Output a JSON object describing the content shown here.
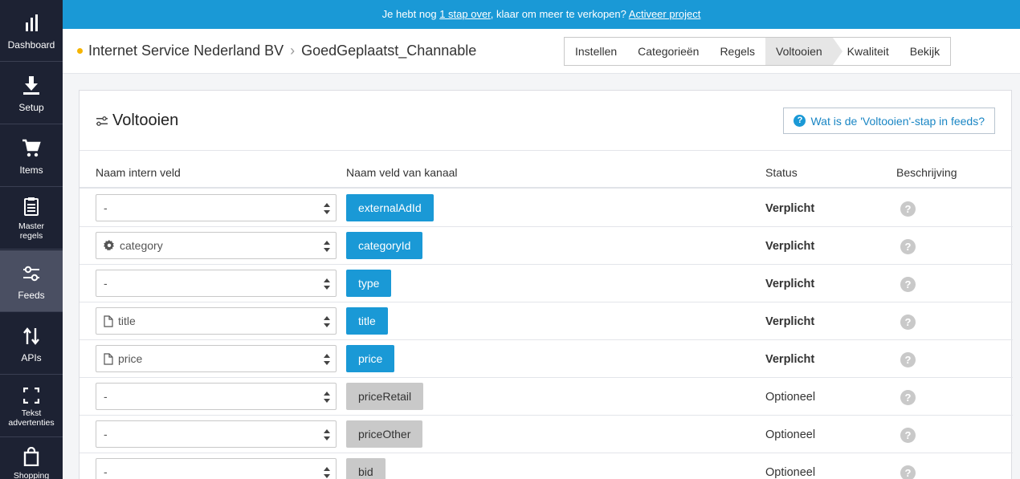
{
  "sidebar": {
    "items": [
      {
        "label": "Dashboard",
        "icon": "bar-chart-icon"
      },
      {
        "label": "Setup",
        "icon": "download-icon"
      },
      {
        "label": "Items",
        "icon": "cart-icon"
      },
      {
        "label": "Master regels",
        "icon": "clipboard-icon"
      },
      {
        "label": "Feeds",
        "icon": "sliders-icon",
        "active": true
      },
      {
        "label": "APIs",
        "icon": "arrows-updown-icon"
      },
      {
        "label": "Tekst advertenties",
        "icon": "frame-corners-icon"
      },
      {
        "label": "Shopping",
        "icon": "shopping-bag-icon"
      }
    ]
  },
  "banner": {
    "prefix": "Je hebt nog ",
    "link1": "1 stap over",
    "middle": ", klaar om meer te verkopen? ",
    "link2": "Activeer project"
  },
  "header": {
    "company": "Internet Service Nederland BV",
    "project": "GoedGeplaatst_Channable",
    "steps": [
      {
        "label": "Instellen"
      },
      {
        "label": "Categorieën"
      },
      {
        "label": "Regels"
      },
      {
        "label": "Voltooien",
        "active": true
      },
      {
        "label": "Kwaliteit"
      },
      {
        "label": "Bekijk"
      }
    ]
  },
  "panel": {
    "title": "Voltooien",
    "help_label": "Wat is de 'Voltooien'-stap in feeds?",
    "columns": {
      "internal": "Naam intern veld",
      "channel": "Naam veld van kanaal",
      "status": "Status",
      "description": "Beschrijving"
    },
    "rows": [
      {
        "internal": "-",
        "icon": "",
        "channel": "externalAdId",
        "status": "Verplicht",
        "required": true
      },
      {
        "internal": "category",
        "icon": "gear-icon",
        "channel": "categoryId",
        "status": "Verplicht",
        "required": true
      },
      {
        "internal": "-",
        "icon": "",
        "channel": "type",
        "status": "Verplicht",
        "required": true
      },
      {
        "internal": "title",
        "icon": "file-icon",
        "channel": "title",
        "status": "Verplicht",
        "required": true
      },
      {
        "internal": "price",
        "icon": "file-icon",
        "channel": "price",
        "status": "Verplicht",
        "required": true
      },
      {
        "internal": "-",
        "icon": "",
        "channel": "priceRetail",
        "status": "Optioneel",
        "required": false
      },
      {
        "internal": "-",
        "icon": "",
        "channel": "priceOther",
        "status": "Optioneel",
        "required": false
      },
      {
        "internal": "-",
        "icon": "",
        "channel": "bid",
        "status": "Optioneel",
        "required": false
      }
    ]
  },
  "colors": {
    "sidebar": "#1d2233",
    "sidebar_active": "#4a4f62",
    "accent": "#1a99d6",
    "optional_tag": "#c9c9c9",
    "status_dot": "#f5b400"
  }
}
